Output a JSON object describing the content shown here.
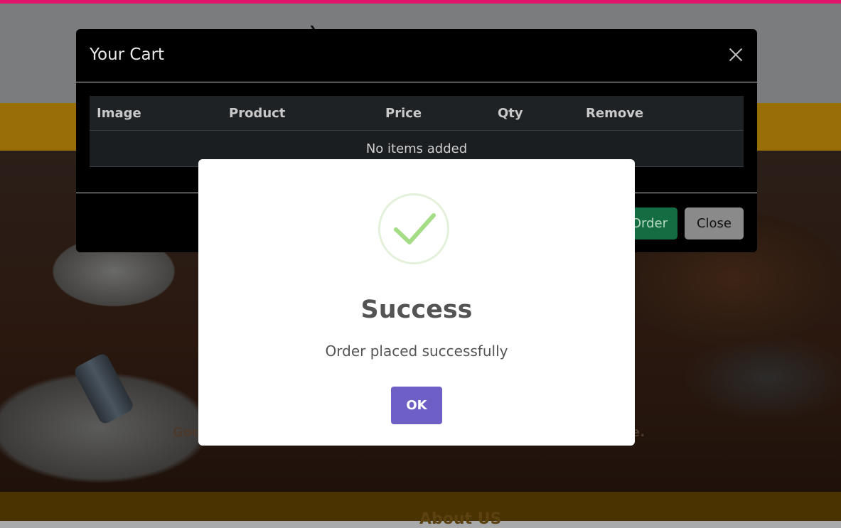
{
  "cart": {
    "title": "Your Cart",
    "columns": [
      "Image",
      "Product",
      "Price",
      "Qty",
      "Remove"
    ],
    "empty_message": "No items added",
    "order_label": "Order",
    "close_label": "Close"
  },
  "alert": {
    "title": "Success",
    "message": "Order placed successfully",
    "ok_label": "OK",
    "icon": "check-icon",
    "icon_color": "#a5dc86"
  },
  "background": {
    "hero_left_fragment": "Goo",
    "hero_right_fragment": "e.",
    "footer_heading_fragment": "About US"
  }
}
